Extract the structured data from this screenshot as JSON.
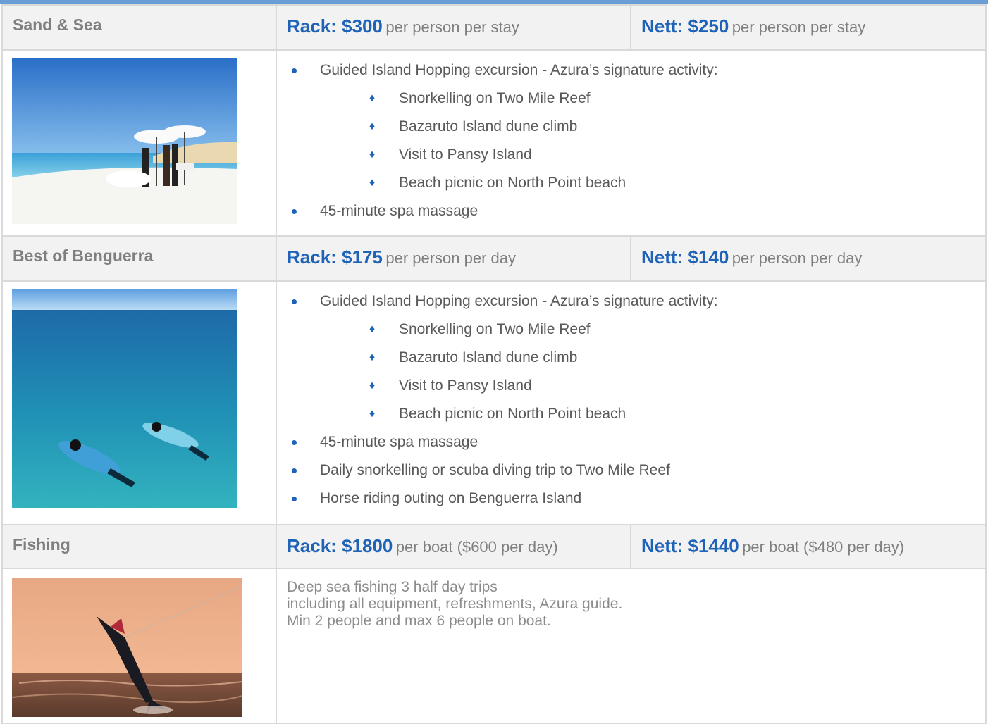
{
  "packages": [
    {
      "name": "Sand & Sea",
      "rack": {
        "label": "Rack: $300",
        "unit": "per person per stay"
      },
      "nett": {
        "label": "Nett: $250",
        "unit": "per person per stay"
      },
      "image": "beach-picnic-photo",
      "items": [
        "Guided Island Hopping excursion - Azura’s signature activity:",
        "Snorkelling on Two Mile Reef",
        "Bazaruto Island dune climb",
        "Visit to Pansy Island",
        "Beach picnic on North Point beach",
        "45-minute spa massage"
      ]
    },
    {
      "name": "Best of Benguerra",
      "rack": {
        "label": "Rack: $175",
        "unit": "per person per day"
      },
      "nett": {
        "label": "Nett: $140",
        "unit": "per person per day"
      },
      "image": "snorkelling-photo",
      "items": [
        "Guided Island Hopping excursion - Azura’s signature activity:",
        "Snorkelling on Two Mile Reef",
        "Bazaruto Island dune climb",
        "Visit to Pansy Island",
        "Beach picnic on North Point beach",
        "45-minute spa massage",
        "Daily snorkelling or scuba diving trip to Two Mile Reef",
        "Horse riding outing on Benguerra Island"
      ]
    },
    {
      "name": "Fishing",
      "rack": {
        "label": "Rack: $1800",
        "unit": "per boat ($600 per day)"
      },
      "nett": {
        "label": "Nett: $1440",
        "unit": "per boat ($480 per day)"
      },
      "image": "marlin-fishing-photo",
      "description": [
        "Deep sea fishing 3 half day trips",
        "including all equipment, refreshments, Azura guide.",
        "Min 2 people and max 6 people on boat."
      ]
    }
  ],
  "colors": {
    "accent": "#1f63b8",
    "header_bg": "#f2f2f2",
    "border": "#d9d9d9",
    "top_bar": "#6a9fd6"
  }
}
